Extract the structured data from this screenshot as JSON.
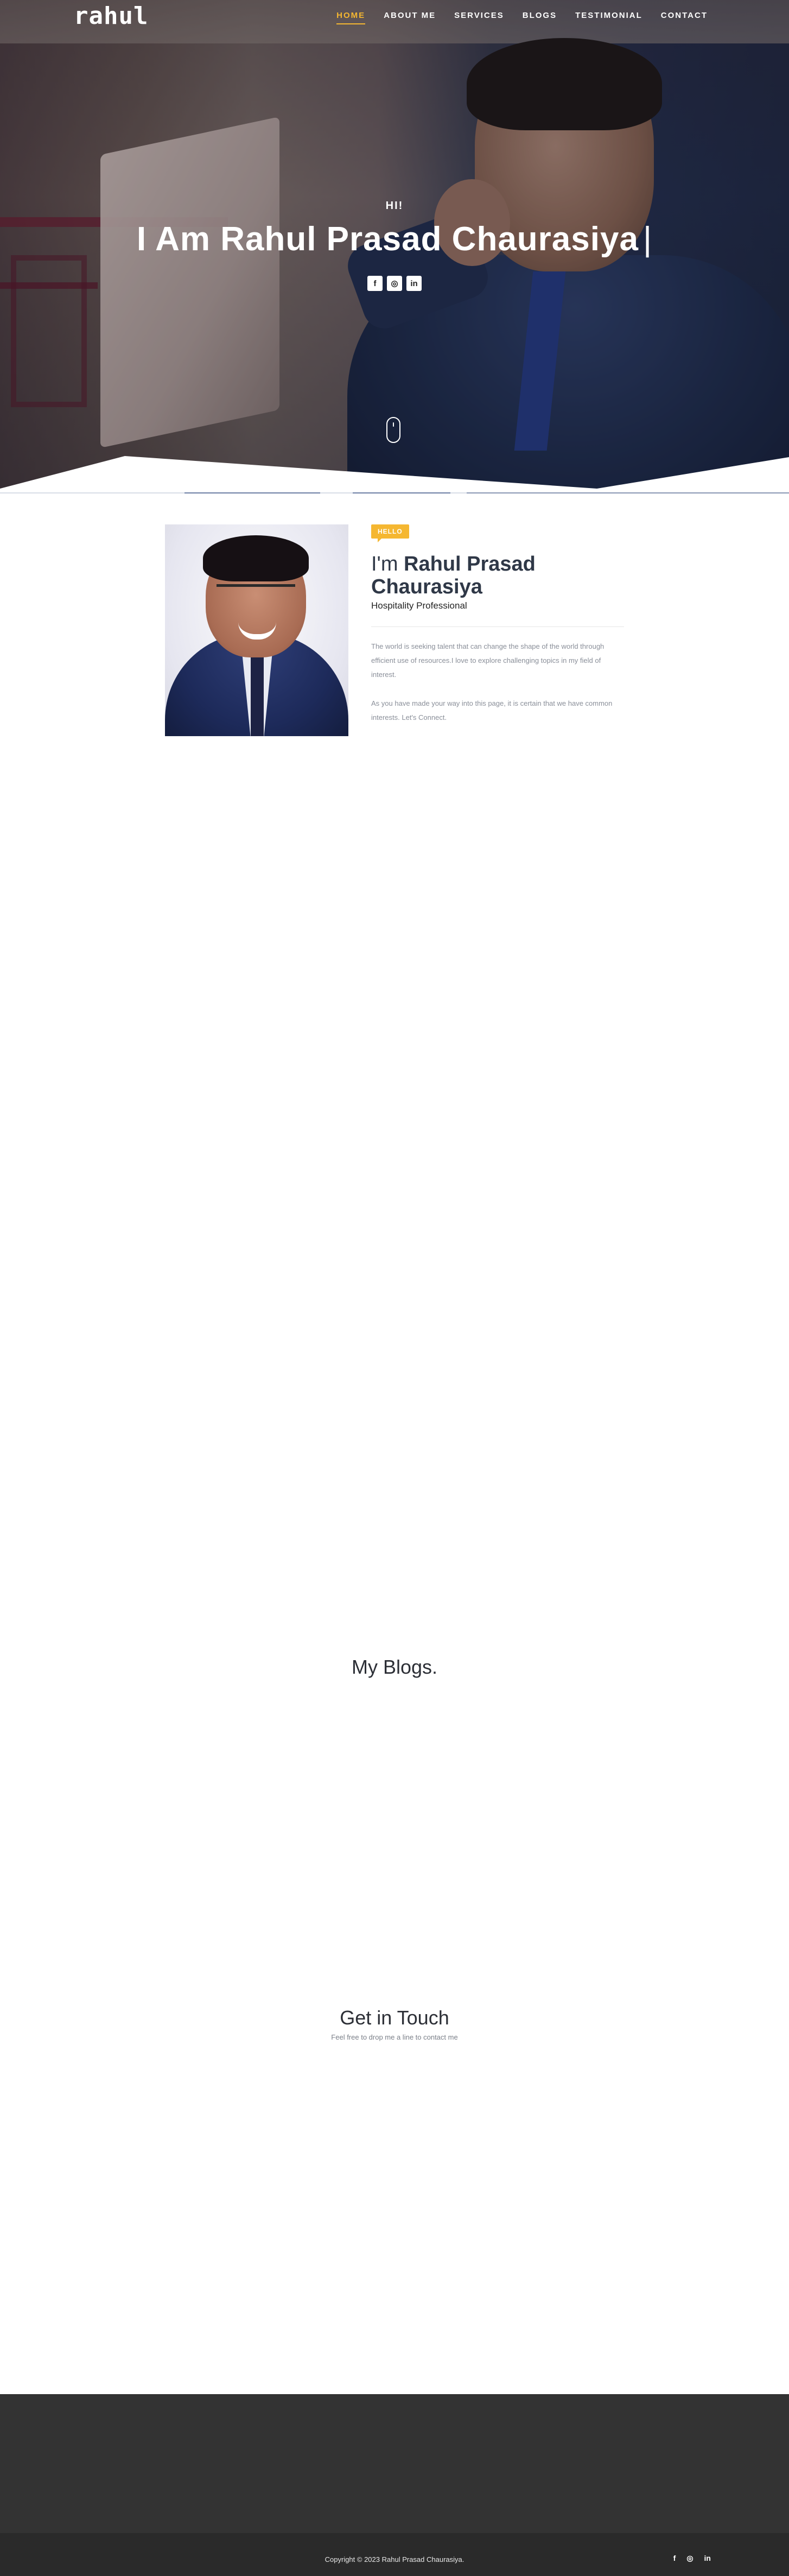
{
  "brand": {
    "logo": "rahul"
  },
  "nav": {
    "items": [
      {
        "label": "HOME",
        "active": true
      },
      {
        "label": "ABOUT ME",
        "active": false
      },
      {
        "label": "SERVICES",
        "active": false
      },
      {
        "label": "BLOGS",
        "active": false
      },
      {
        "label": "TESTIMONIAL",
        "active": false
      },
      {
        "label": "CONTACT",
        "active": false
      }
    ]
  },
  "hero": {
    "greeting": "HI!",
    "title": "I Am Rahul Prasad Chaurasiya",
    "cursor": "|",
    "social": [
      {
        "icon": "facebook-icon",
        "glyph": "f"
      },
      {
        "icon": "instagram-icon",
        "glyph": "◎"
      },
      {
        "icon": "linkedin-icon",
        "glyph": "in"
      }
    ]
  },
  "about": {
    "badge": "HELLO",
    "heading_pre": "I'm",
    "heading_name": "Rahul Prasad Chaurasiya",
    "role": "Hospitality Professional",
    "paragraph_1": "The world is seeking talent that can change the shape of the world through efficient use of resources.I love to explore challenging topics in my field of interest.",
    "paragraph_2": "As you have made your way into this page, it is certain that we have common interests. Let's Connect."
  },
  "blogs": {
    "title": "My Blogs."
  },
  "contact": {
    "title": "Get in Touch",
    "subtitle": "Feel free to drop me a line to contact me"
  },
  "footer": {
    "copyright": "Copyright © 2023 Rahul Prasad Chaurasiya.",
    "social": [
      {
        "icon": "facebook-icon",
        "glyph": "f"
      },
      {
        "icon": "instagram-icon",
        "glyph": "◎"
      },
      {
        "icon": "linkedin-icon",
        "glyph": "in"
      }
    ]
  },
  "colors": {
    "accent": "#f5b731",
    "footer_dark": "#333333",
    "footer_darker": "#2a2a2a"
  }
}
